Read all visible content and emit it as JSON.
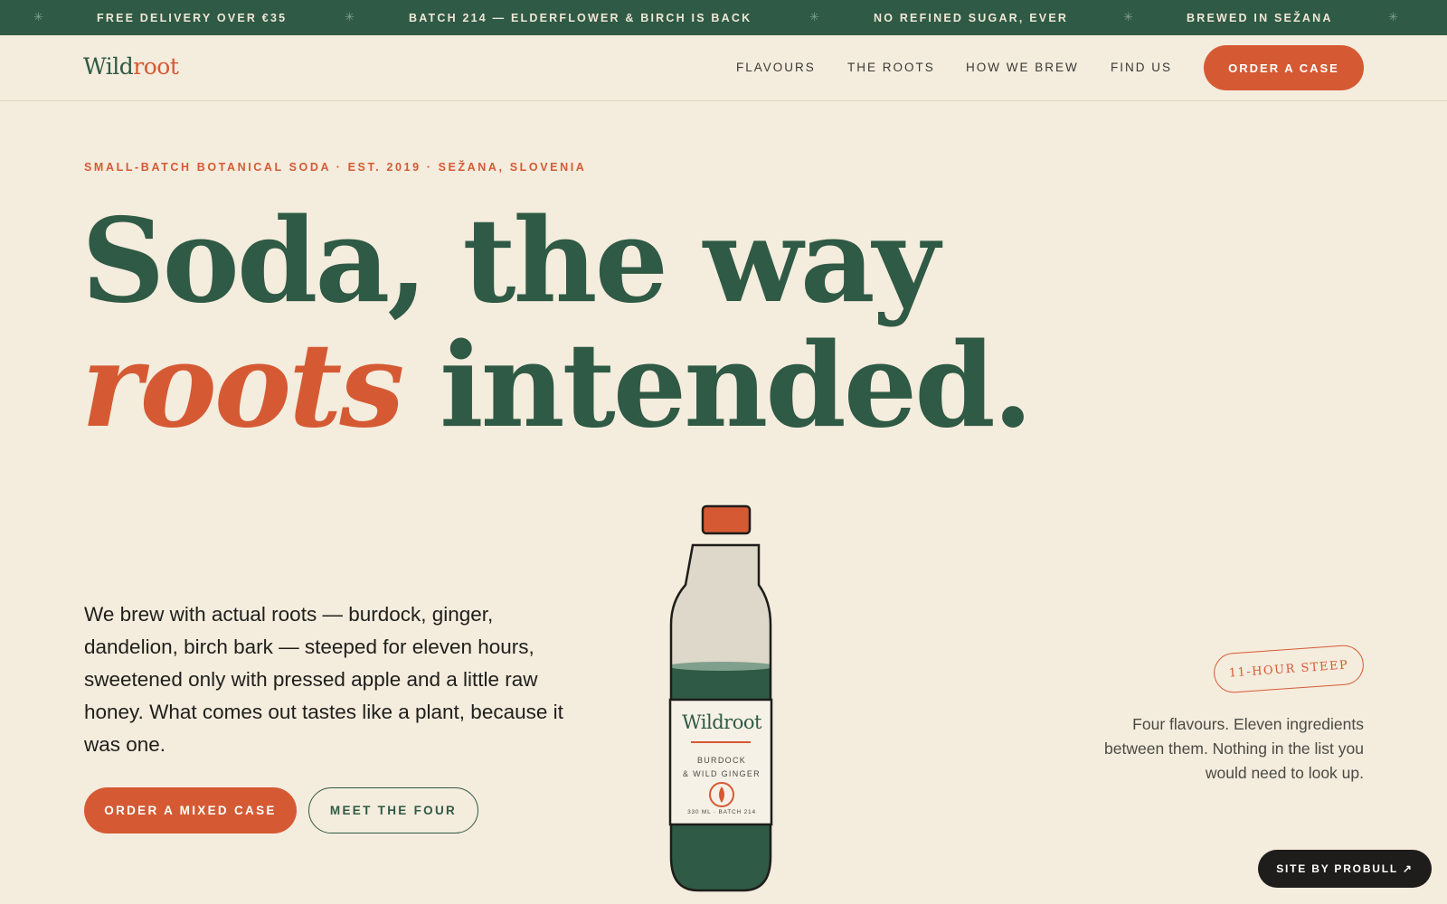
{
  "announcement_bar": {
    "separator_glyph": "✳",
    "messages": [
      "FREE DELIVERY OVER €35",
      "BATCH 214 — ELDERFLOWER & BIRCH IS BACK",
      "NO REFINED SUGAR, EVER",
      "BREWED IN SEŽANA"
    ]
  },
  "header": {
    "logo": {
      "part1": "Wild",
      "part2": "root"
    },
    "nav": [
      "FLAVOURS",
      "THE ROOTS",
      "HOW WE BREW",
      "FIND US"
    ],
    "cta_label": "ORDER A CASE"
  },
  "hero": {
    "eyebrow": "SMALL-BATCH BOTANICAL SODA · EST. 2019 · SEŽANA, SLOVENIA",
    "headline_line1": "Soda, the way",
    "headline_accent": "roots",
    "headline_line2_rest": " intended.",
    "body": "We brew with actual roots — burdock, ginger, dandelion, birch bark — steeped for eleven hours, sweetened only with pressed apple and a little raw honey. What comes out tastes like a plant, because it was one.",
    "primary_button": "ORDER A MIXED CASE",
    "secondary_button": "MEET THE FOUR"
  },
  "bottle": {
    "brand": "Wildroot",
    "flavour_line1": "BURDOCK",
    "flavour_line2": "& WILD GINGER",
    "volume": "330 ML · BATCH 214"
  },
  "side_note": {
    "tag": "11-HOUR STEEP",
    "text": "Four flavours. Eleven ingredients between them. Nothing in the list you would need to look up."
  },
  "credit_label": "SITE BY PROBULL ↗",
  "colors": {
    "forest_green": "#2f5a45",
    "terracotta": "#d55a34",
    "cream": "#f4ecdd",
    "ink": "#1e1d1b"
  }
}
